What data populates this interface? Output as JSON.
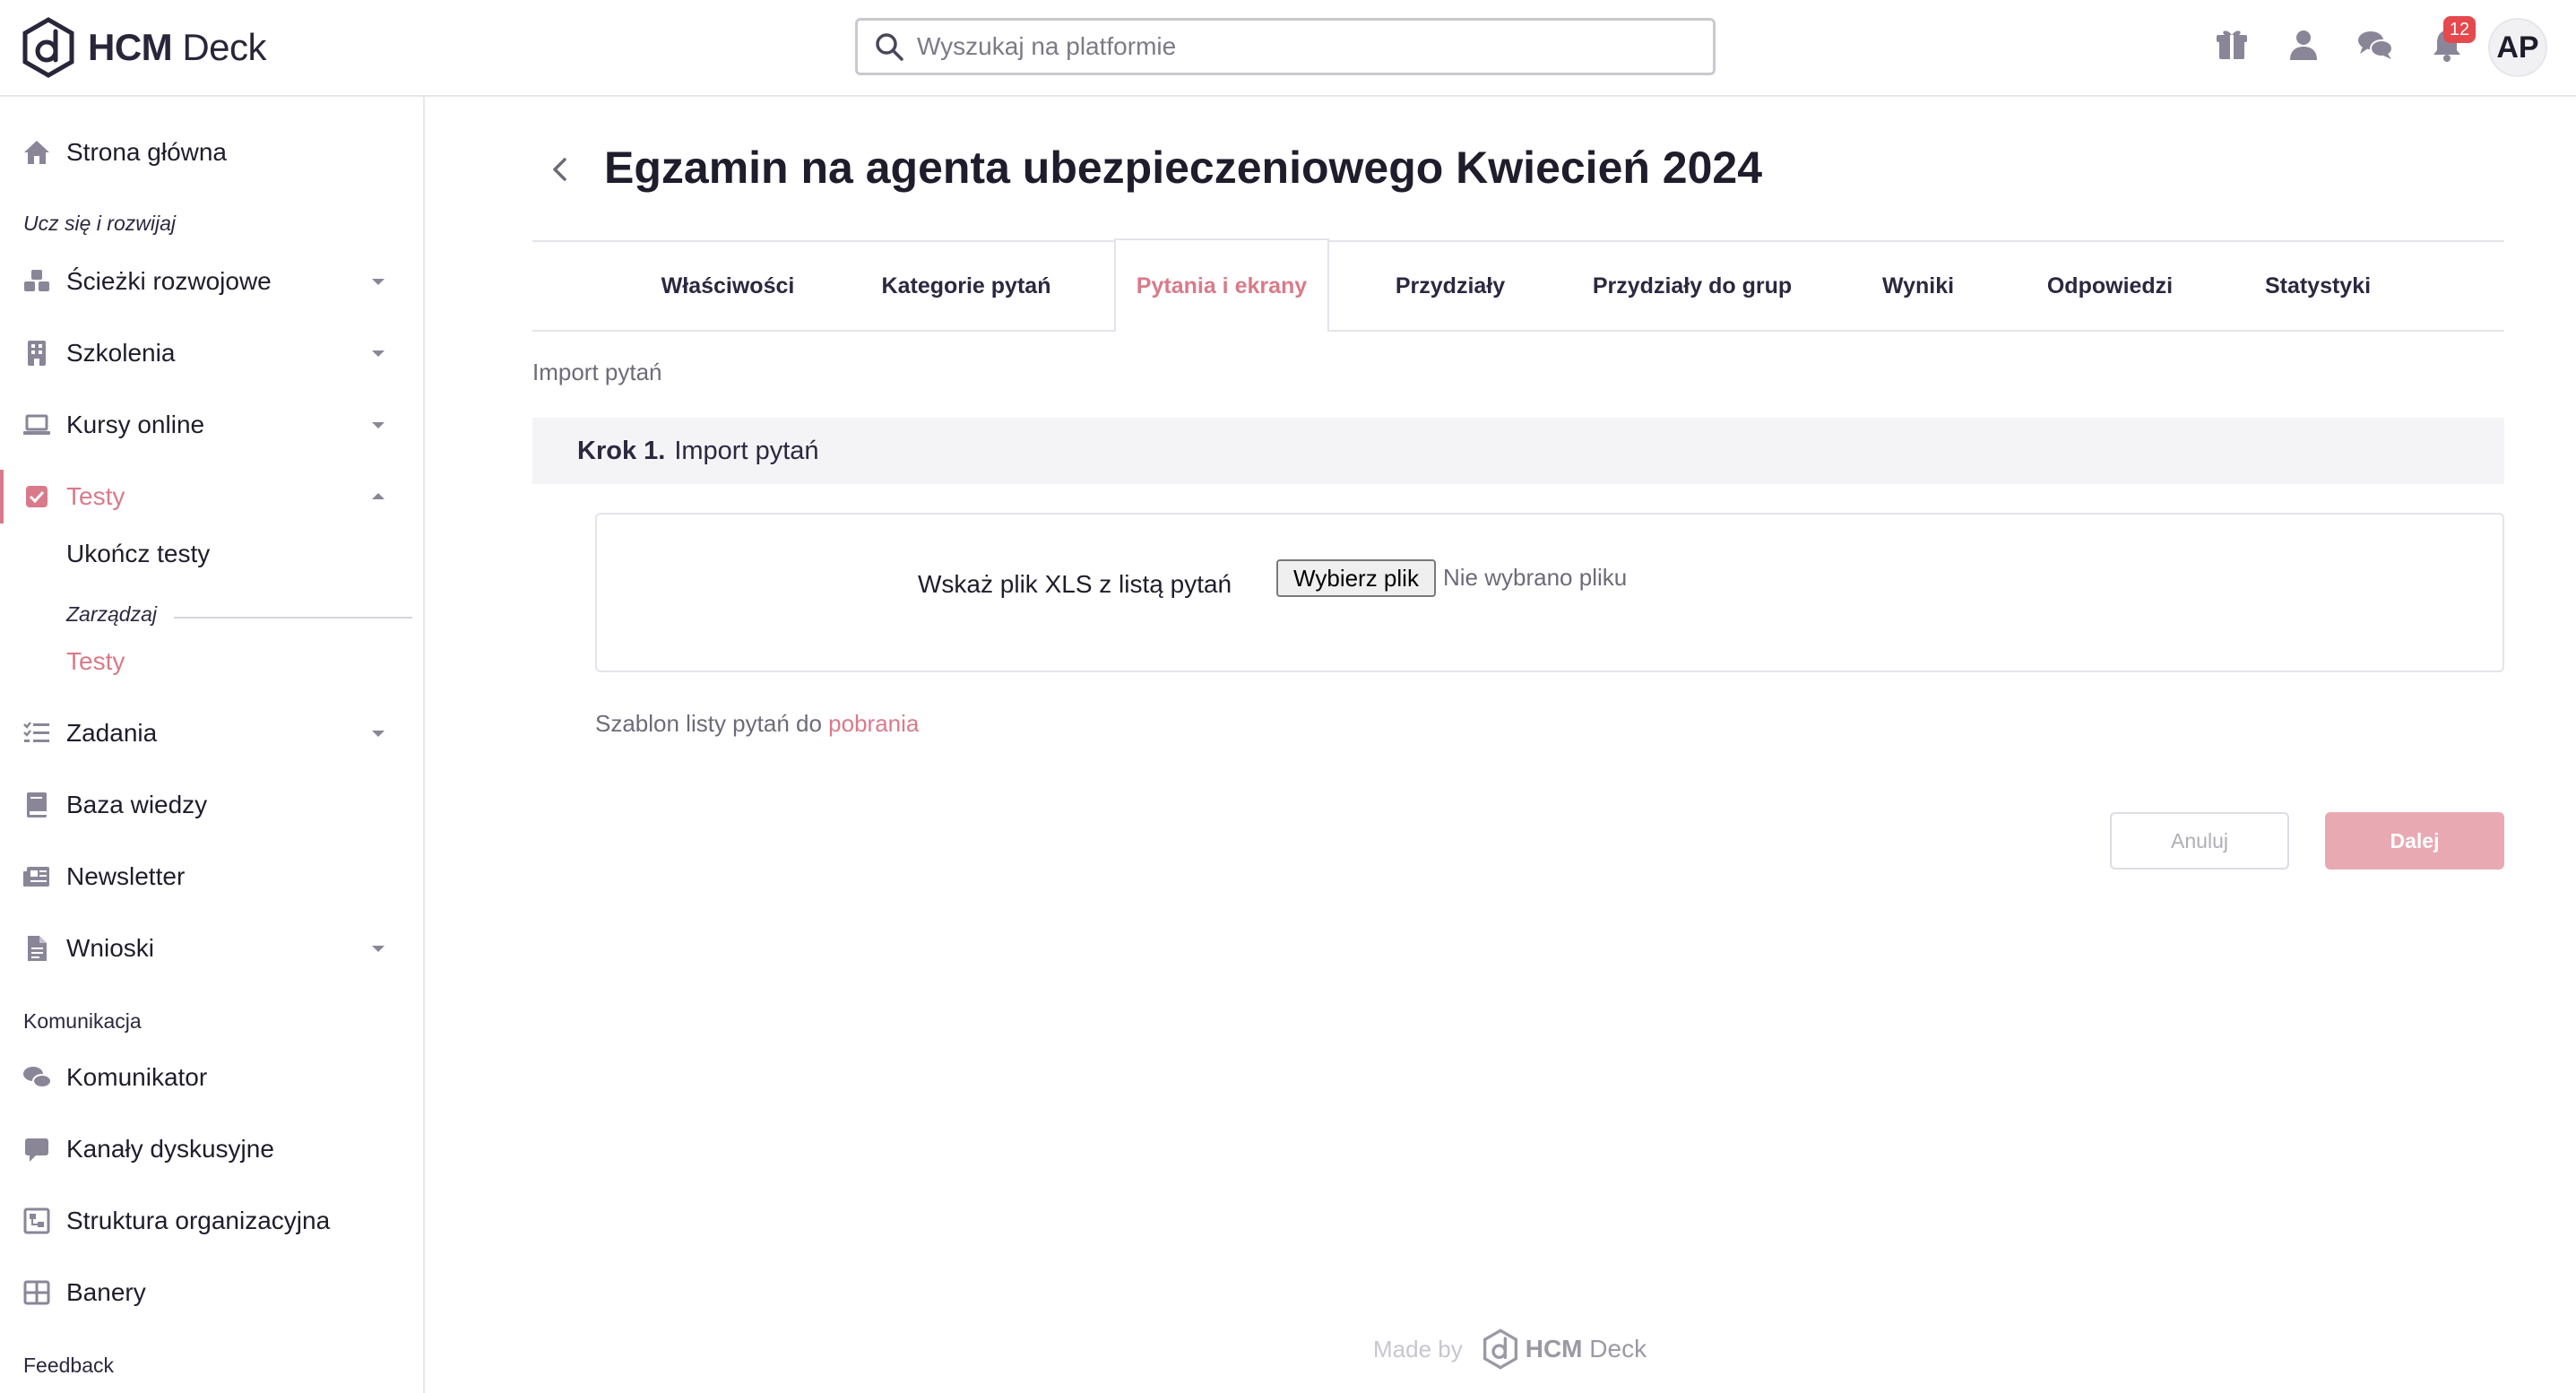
{
  "brand": {
    "name_bold": "HCM",
    "name_rest": " Deck"
  },
  "search": {
    "placeholder": "Wyszukaj na platformie"
  },
  "topbar": {
    "icons": [
      "gift-icon",
      "user-icon",
      "chat-icon",
      "bell-icon"
    ],
    "notifications_count": "12",
    "avatar_initials": "AP"
  },
  "sidebar": {
    "home": "Strona główna",
    "section_learn": "Ucz się i rozwijaj",
    "learn_items": [
      "Ścieżki rozwojowe",
      "Szkolenia",
      "Kursy online",
      "Testy"
    ],
    "tests_sub": "Ukończ testy",
    "manage_label": "Zarządzaj",
    "manage_tests": "Testy",
    "other_items": [
      "Zadania",
      "Baza wiedzy",
      "Newsletter",
      "Wnioski"
    ],
    "section_comm": "Komunikacja",
    "comm_items": [
      "Komunikator",
      "Kanały dyskusyjne",
      "Struktura organizacyjna",
      "Banery"
    ],
    "section_feedback": "Feedback"
  },
  "main": {
    "title": "Egzamin na agenta ubezpieczeniowego Kwiecień 2024",
    "tabs": [
      "Właściwości",
      "Kategorie pytań",
      "Pytania i ekrany",
      "Przydziały",
      "Przydziały do grup",
      "Wyniki",
      "Odpowiedzi",
      "Statystyki"
    ],
    "active_tab": "Pytania i ekrany",
    "breadcrumb": "Import pytań",
    "step_label": "Krok 1.",
    "step_title": "Import pytań",
    "upload_label": "Wskaż plik XLS z listą pytań",
    "file_button": "Wybierz plik",
    "file_status": "Nie wybrano pliku",
    "template_text": "Szablon listy pytań do ",
    "template_link": "pobrania",
    "cancel": "Anuluj",
    "next": "Dalej"
  },
  "footer": {
    "made_by": "Made by",
    "logo_bold": "HCM",
    "logo_rest": " Deck"
  },
  "colors": {
    "accent": "#d97a8a",
    "accent_disabled": "#e9a9b3",
    "icon": "#8a8698",
    "badge": "#e5484d"
  }
}
